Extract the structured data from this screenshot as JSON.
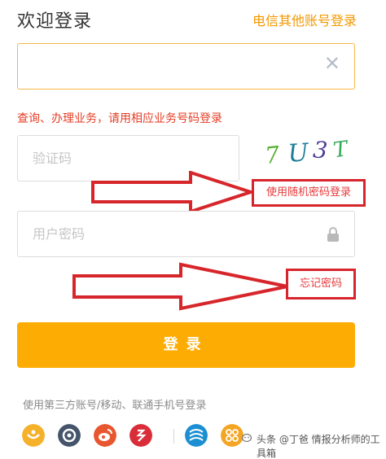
{
  "header": {
    "title": "欢迎登录",
    "other_account_link": "电信其他账号登录"
  },
  "phone": {
    "value": "",
    "clear_icon": "close-icon",
    "clear_glyph": "✕"
  },
  "notice": "查询、办理业务，请用相应业务号码登录",
  "code": {
    "placeholder": "验证码",
    "captcha_text": "7U3T"
  },
  "links": {
    "random_password": "使用随机密码登录",
    "forgot_password": "忘记密码"
  },
  "password": {
    "placeholder": "用户密码",
    "icon": "lock-icon"
  },
  "login_button": "登录",
  "third_party": {
    "label": "使用第三方账号/移动、联通手机号登录",
    "icons": [
      "yiliao-icon",
      "tianyi-icon",
      "weibo-icon",
      "yixin-icon",
      "china-mobile-icon",
      "china-unicom-icon"
    ]
  },
  "watermark": "头条 @丁爸 情报分析师的工具箱",
  "colors": {
    "accent": "#f39800",
    "button": "#fdac04",
    "notice": "#e53d25",
    "annotation_red": "#d7262b"
  }
}
